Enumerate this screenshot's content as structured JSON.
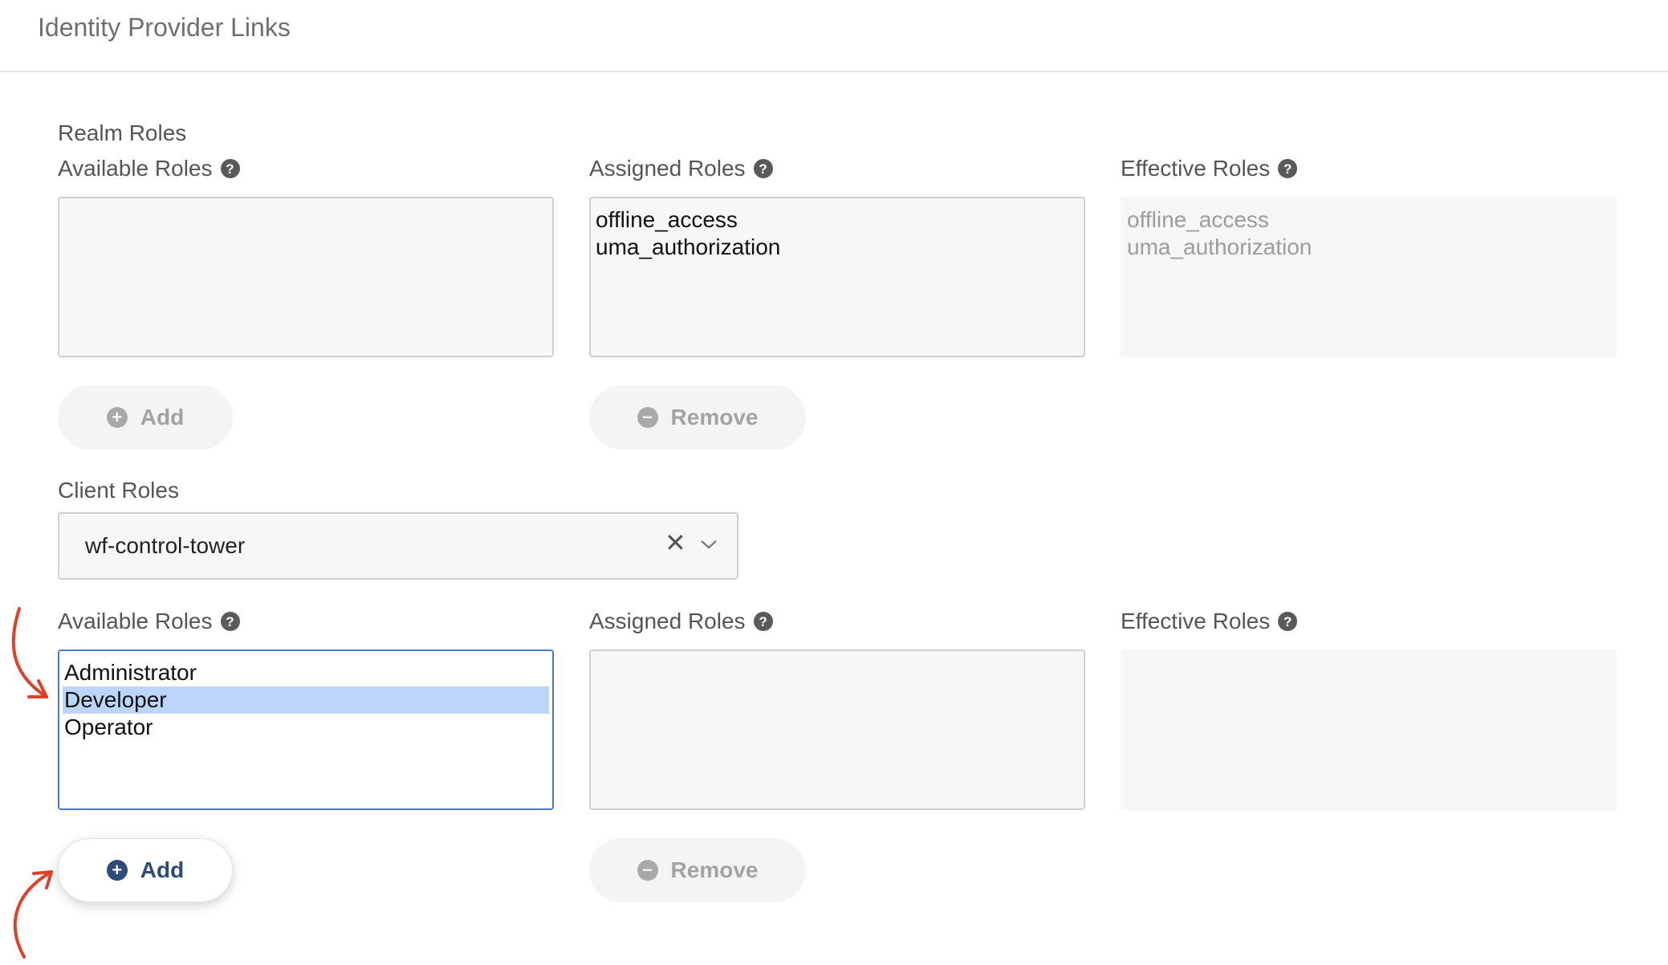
{
  "header": {
    "tab_title": "Identity Provider Links"
  },
  "realm_roles": {
    "section_label": "Realm Roles",
    "available": {
      "label": "Available Roles",
      "options": []
    },
    "assigned": {
      "label": "Assigned Roles",
      "options": [
        "offline_access",
        "uma_authorization"
      ]
    },
    "effective": {
      "label": "Effective Roles",
      "options": [
        "offline_access",
        "uma_authorization"
      ]
    },
    "add_label": "Add",
    "remove_label": "Remove"
  },
  "client_roles": {
    "section_label": "Client Roles",
    "client_select": {
      "value": "wf-control-tower",
      "clear_glyph": "✕"
    },
    "available": {
      "label": "Available Roles",
      "options": [
        "Administrator",
        "Developer",
        "Operator"
      ],
      "selected": "Developer"
    },
    "assigned": {
      "label": "Assigned Roles",
      "options": []
    },
    "effective": {
      "label": "Effective Roles",
      "options": []
    },
    "add_label": "Add",
    "remove_label": "Remove"
  },
  "icons": {
    "help": "question-circle-icon",
    "add": "plus-circle-icon",
    "remove": "minus-circle-icon",
    "clear": "close-icon",
    "dropdown": "chevron-down-icon"
  },
  "colors": {
    "accent": "#2e4b79",
    "selection": "#bcd6fb",
    "focus_border": "#4a7bd0",
    "annotation_arrow": "#e0402a"
  }
}
